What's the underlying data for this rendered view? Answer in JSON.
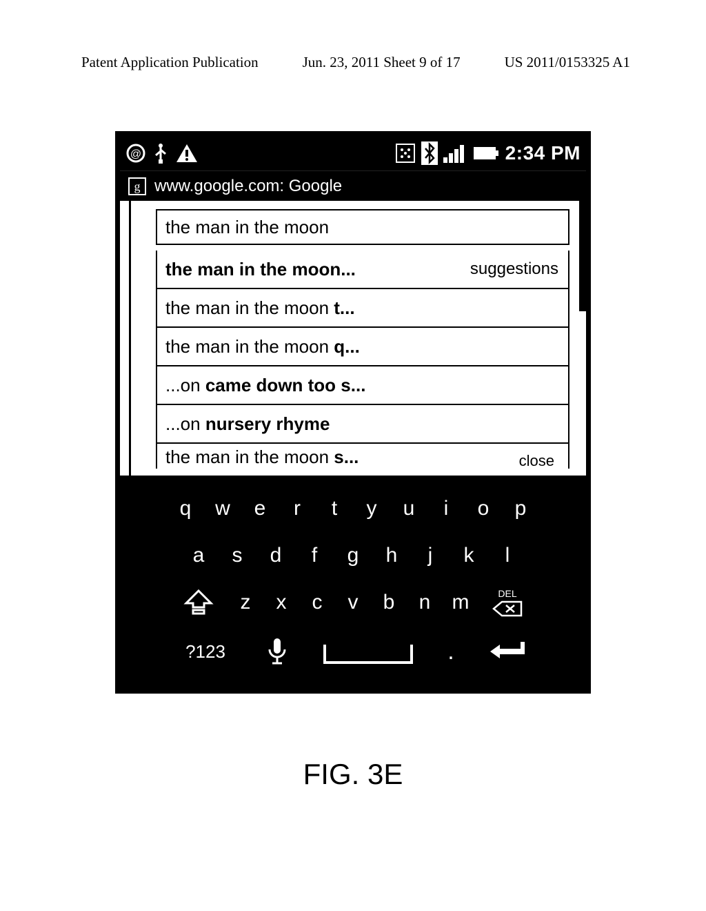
{
  "doc_header": {
    "left": "Patent Application Publication",
    "mid": "Jun. 23, 2011  Sheet 9 of 17",
    "right": "US 2011/0153325 A1"
  },
  "status": {
    "time": "2:34 PM"
  },
  "urlbar": {
    "favicon_letter": "g",
    "url_text": "www.google.com: Google"
  },
  "search": {
    "query": "the man in the moon",
    "suggestions_label": "suggestions",
    "close_label": "close",
    "items": [
      {
        "prefix": "",
        "bold": "the man in the moon...",
        "suffix": "",
        "has_label": true
      },
      {
        "prefix": "the man in the moon ",
        "bold": "t...",
        "suffix": ""
      },
      {
        "prefix": "the man in the moon ",
        "bold": "q...",
        "suffix": ""
      },
      {
        "prefix": "...on ",
        "bold": "came down too s...",
        "suffix": ""
      },
      {
        "prefix": "...on ",
        "bold": "nursery rhyme",
        "suffix": ""
      },
      {
        "prefix": "the man in the moon ",
        "bold": "s...",
        "suffix": "",
        "partial": true
      }
    ]
  },
  "keyboard": {
    "row1": [
      "q",
      "w",
      "e",
      "r",
      "t",
      "y",
      "u",
      "i",
      "o",
      "p"
    ],
    "row2": [
      "a",
      "s",
      "d",
      "f",
      "g",
      "h",
      "j",
      "k",
      "l"
    ],
    "row3": [
      "z",
      "x",
      "c",
      "v",
      "b",
      "n",
      "m"
    ],
    "del_label": "DEL",
    "num_label": "?123",
    "period": "."
  },
  "figure_label": "FIG. 3E"
}
